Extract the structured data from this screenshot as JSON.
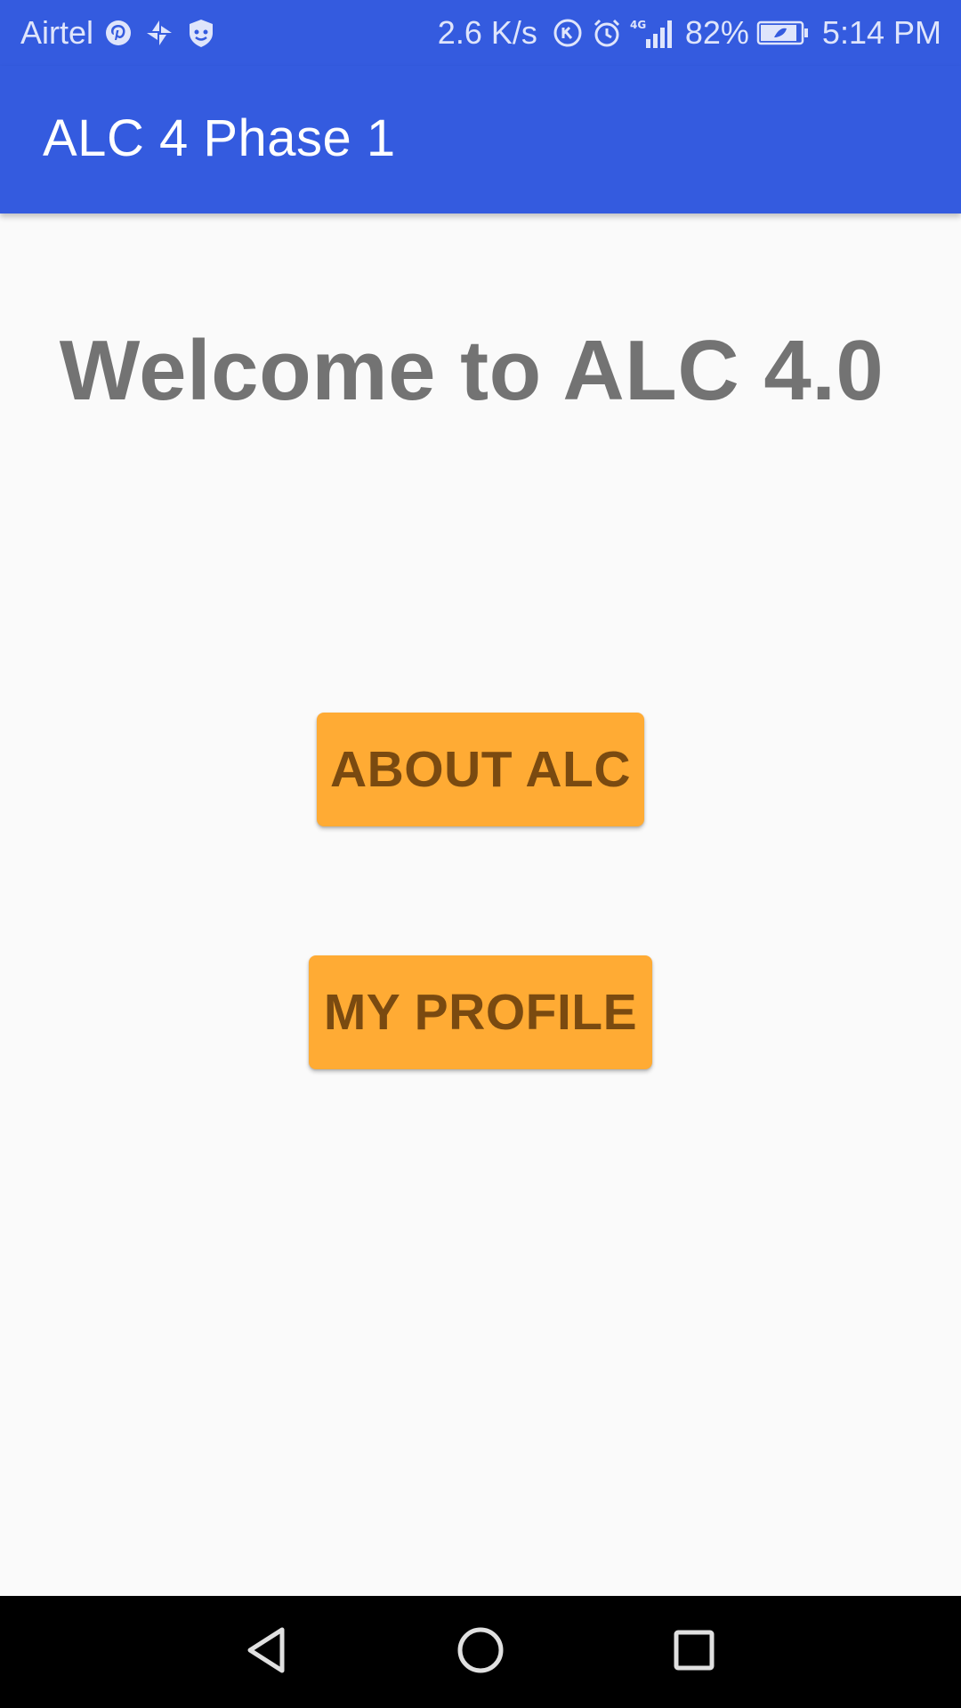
{
  "status_bar": {
    "carrier": "Airtel",
    "left_icons": [
      "pinterest-icon",
      "pinwheel-icon",
      "shield-face-icon"
    ],
    "net_speed": "2.6 K/s",
    "right_icons": [
      "data-saver-icon",
      "alarm-icon",
      "4g-signal-icon"
    ],
    "battery_percent": "82%",
    "battery_icon": "battery-saver-icon",
    "time": "5:14 PM"
  },
  "app_bar": {
    "title": "ALC 4 Phase 1"
  },
  "main": {
    "welcome_text": "Welcome to ALC 4.0",
    "about_button_label": "ABOUT ALC",
    "profile_button_label": "MY PROFILE"
  },
  "nav_bar": {
    "icons": [
      "back-icon",
      "home-icon",
      "recents-icon"
    ]
  },
  "colors": {
    "primary": "#345bdf",
    "accent": "#ffab34",
    "accent_text": "#7a4a10",
    "welcome_text": "#737373",
    "background": "#fafafa",
    "nav_bar": "#000000"
  }
}
